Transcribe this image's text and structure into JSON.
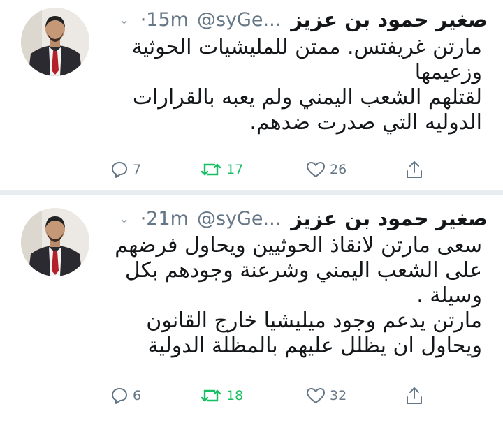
{
  "tweets": [
    {
      "author_name": "صغير حمود بن عزيز",
      "handle": "@syGe...",
      "time": "·15m",
      "text": "مارتن غريفتس. ممتن للمليشيات الحوثية\nوزعيمها\nلقتلهم الشعب اليمني ولم يعبه بالقرارات\nالدوليه التي صدرت ضدهم.",
      "replies": "7",
      "retweets": "17",
      "likes": "26"
    },
    {
      "author_name": "صغير حمود بن عزيز",
      "handle": "@syGe...",
      "time": "·21m",
      "text": "سعى مارتن لانقاذ الحوثيين ويحاول فرضهم\nعلى الشعب اليمني وشرعنة وجودهم بكل\nوسيلة .\nمارتن يدعم وجود ميليشيا خارج القانون\nويحاول ان يظلل عليهم بالمظلة الدولية",
      "replies": "6",
      "retweets": "18",
      "likes": "32"
    }
  ],
  "colors": {
    "retweet_green": "#17bf63",
    "meta_gray": "#657786",
    "divider": "#e6ecf0"
  },
  "icons": [
    "chevron-down-icon",
    "reply-icon",
    "retweet-icon",
    "like-icon",
    "share-icon"
  ]
}
